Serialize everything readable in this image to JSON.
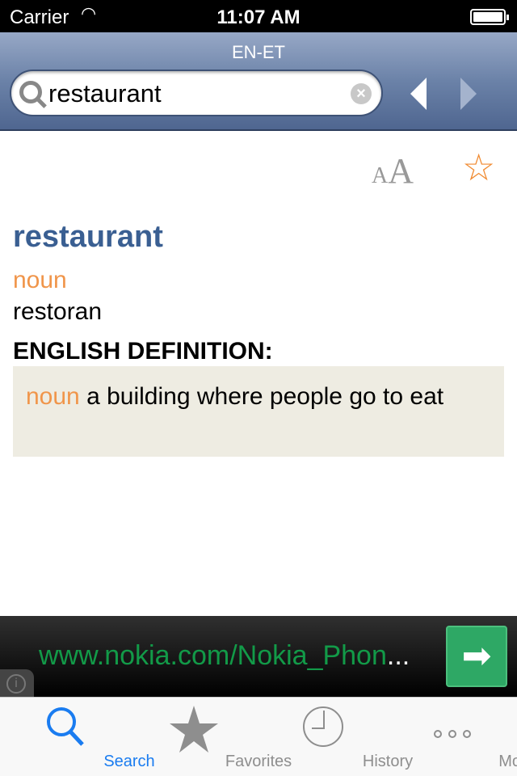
{
  "status": {
    "carrier": "Carrier",
    "time": "11:07 AM"
  },
  "nav": {
    "title": "EN-ET",
    "search_value": "restaurant"
  },
  "entry": {
    "word": "restaurant",
    "pos": "noun",
    "translation": "restoran",
    "definition_heading": "ENGLISH DEFINITION:",
    "definition_pos": "noun",
    "definition_text": " a building where people go to eat"
  },
  "toolbar": {
    "font_small": "A",
    "font_large": "A",
    "favorite_icon": "star-outline-icon"
  },
  "ad": {
    "url": "www.nokia.com/Nokia_Phon",
    "ellipsis": "..."
  },
  "tabs": [
    {
      "label": "Search"
    },
    {
      "label": "Favorites"
    },
    {
      "label": "History"
    },
    {
      "label": "More"
    }
  ],
  "colors": {
    "accent": "#1a7cf0",
    "headword": "#3a5f92",
    "pos": "#f0954a",
    "favorite": "#f08a30"
  }
}
